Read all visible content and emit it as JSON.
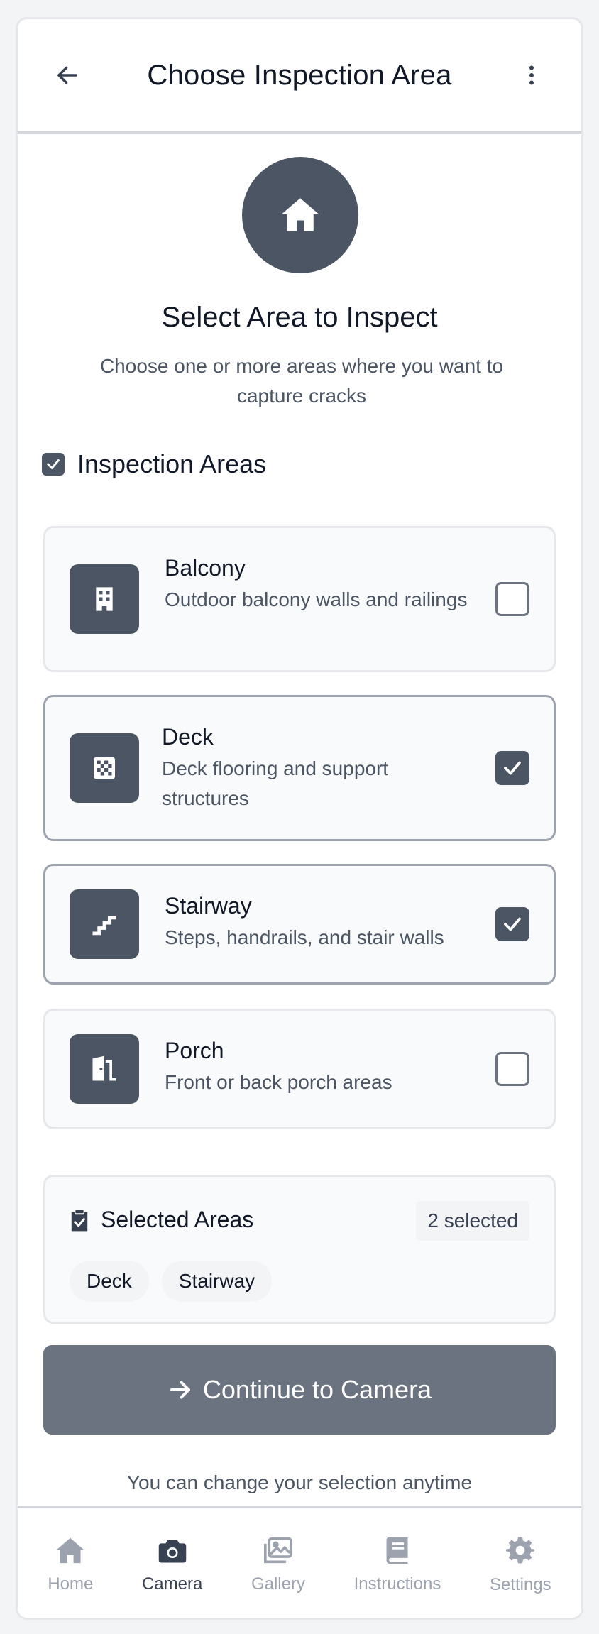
{
  "header": {
    "title": "Choose Inspection Area",
    "back_icon": "arrow-left-icon",
    "menu_icon": "more-vertical-icon"
  },
  "hero": {
    "icon": "home-icon",
    "title": "Select Area to Inspect",
    "subtitle": "Choose one or more areas where you want to capture cracks"
  },
  "section": {
    "title": "Inspection Areas",
    "checked": true
  },
  "areas": [
    {
      "name": "Balcony",
      "description": "Outdoor balcony walls and railings",
      "icon": "building-icon",
      "checked": false
    },
    {
      "name": "Deck",
      "description": "Deck flooring and support structures",
      "icon": "checkered-icon",
      "checked": true
    },
    {
      "name": "Stairway",
      "description": "Steps, handrails, and stair walls",
      "icon": "stairs-icon",
      "checked": true
    },
    {
      "name": "Porch",
      "description": "Front or back porch areas",
      "icon": "door-open-icon",
      "checked": false
    }
  ],
  "summary": {
    "title": "Selected Areas",
    "count_label": "2 selected",
    "chips": [
      "Deck",
      "Stairway"
    ],
    "icon": "clipboard-check-icon"
  },
  "continue_button": {
    "label": "Continue to Camera",
    "icon": "arrow-right-icon"
  },
  "hint": "You can change your selection anytime",
  "nav": [
    {
      "label": "Home",
      "icon": "home-icon",
      "active": false
    },
    {
      "label": "Camera",
      "icon": "camera-icon",
      "active": true
    },
    {
      "label": "Gallery",
      "icon": "images-icon",
      "active": false
    },
    {
      "label": "Instructions",
      "icon": "book-icon",
      "active": false
    },
    {
      "label": "Settings",
      "icon": "gear-icon",
      "active": false
    }
  ],
  "colors": {
    "primary": "#4b5563",
    "button": "#6b7280",
    "card_bg": "#f9fafb",
    "border": "#e5e7eb",
    "nav_inactive": "#9ca3af"
  }
}
